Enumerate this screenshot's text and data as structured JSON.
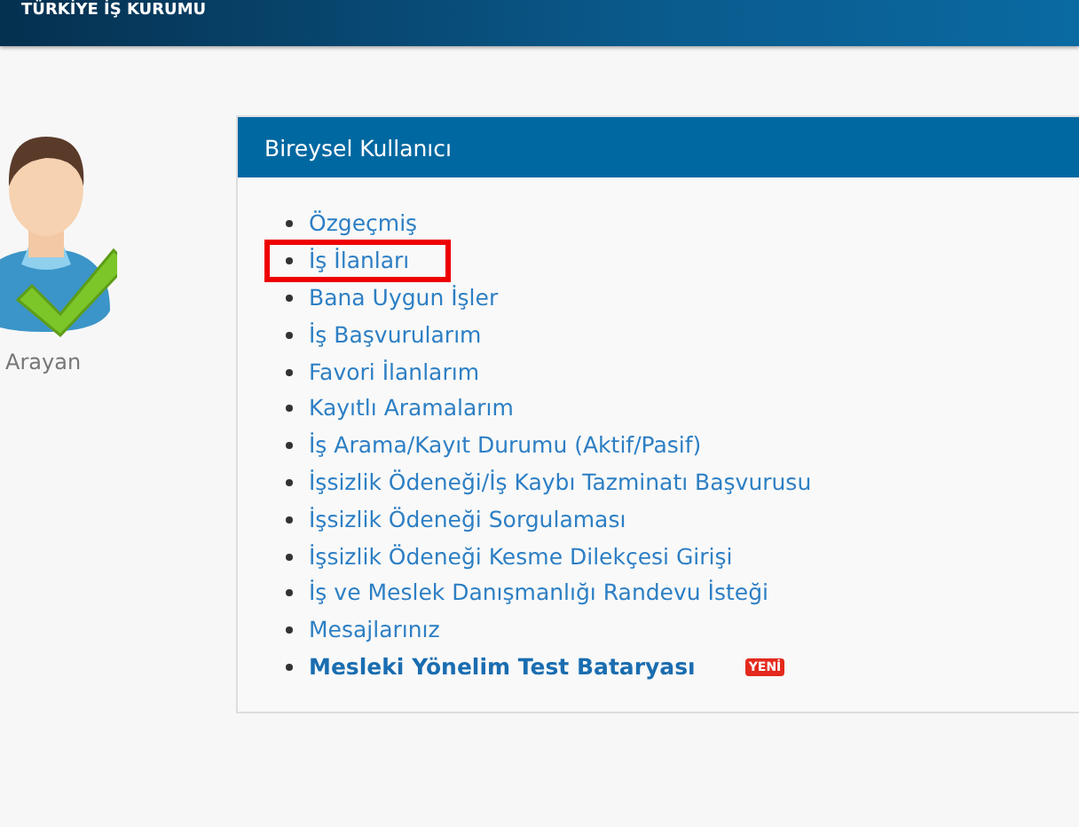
{
  "header": {
    "org_name": "TÜRKİYE İŞ KURUMU"
  },
  "profile": {
    "label": "Arayan"
  },
  "panel": {
    "title": "Bireysel Kullanıcı",
    "items": [
      {
        "label": "Özgeçmiş",
        "kind": "link",
        "highlighted": false
      },
      {
        "label": "İş İlanları",
        "kind": "link",
        "highlighted": true
      },
      {
        "label": "Bana Uygun İşler",
        "kind": "link",
        "highlighted": false
      },
      {
        "label": "İş Başvurularım",
        "kind": "link",
        "highlighted": false
      },
      {
        "label": "Favori İlanlarım",
        "kind": "link",
        "highlighted": false
      },
      {
        "label": "Kayıtlı Aramalarım",
        "kind": "link",
        "highlighted": false
      },
      {
        "label": "İş Arama/Kayıt Durumu (Aktif/Pasif)",
        "kind": "link",
        "highlighted": false
      },
      {
        "label": "İşsizlik Ödeneği/İş Kaybı Tazminatı Başvurusu",
        "kind": "link",
        "highlighted": false
      },
      {
        "label": "İşsizlik Ödeneği Sorgulaması",
        "kind": "link",
        "highlighted": false
      },
      {
        "label": "İşsizlik Ödeneği Kesme Dilekçesi Girişi",
        "kind": "link",
        "highlighted": false
      },
      {
        "label": "İş ve Meslek Danışmanlığı Randevu İsteği",
        "kind": "link",
        "highlighted": false
      },
      {
        "label": "Mesajlarınız",
        "kind": "link",
        "highlighted": false
      },
      {
        "label": "Mesleki Yönelim Test Bataryası",
        "kind": "featured",
        "highlighted": false,
        "badge": "YENİ"
      }
    ]
  }
}
